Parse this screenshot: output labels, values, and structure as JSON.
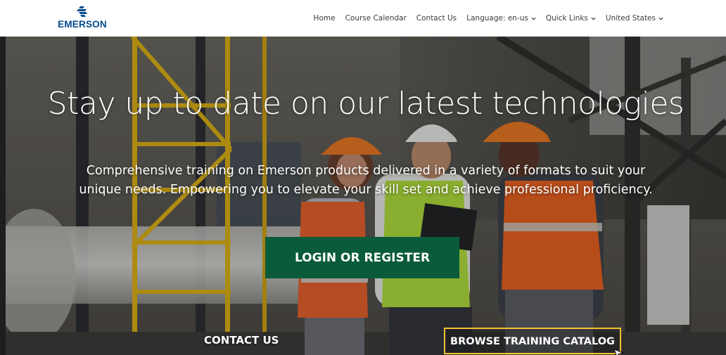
{
  "brand": {
    "name": "EMERSON",
    "primary_color": "#004b8d",
    "logo_icon": "emerson-logo-icon"
  },
  "nav": {
    "items": [
      {
        "label": "Home",
        "has_dropdown": false
      },
      {
        "label": "Course Calendar",
        "has_dropdown": false
      },
      {
        "label": "Contact Us",
        "has_dropdown": false
      },
      {
        "label": "Language: en-us",
        "has_dropdown": true
      },
      {
        "label": "Quick Links",
        "has_dropdown": true
      },
      {
        "label": "United States",
        "has_dropdown": true
      }
    ],
    "dropdown_icon": "chevron-down-icon"
  },
  "hero": {
    "headline": "Stay up to date on our latest technologies",
    "subtext": "Comprehensive training on Emerson products delivered in a variety of formats to suit your unique needs. Empowering you to elevate your skill set and achieve professional proficiency.",
    "login_button": "LOGIN OR REGISTER",
    "contact_link": "CONTACT US",
    "catalog_button": "BROWSE TRAINING CATALOG",
    "login_color": "#0a5b3a",
    "catalog_border_color": "#f2c230"
  }
}
